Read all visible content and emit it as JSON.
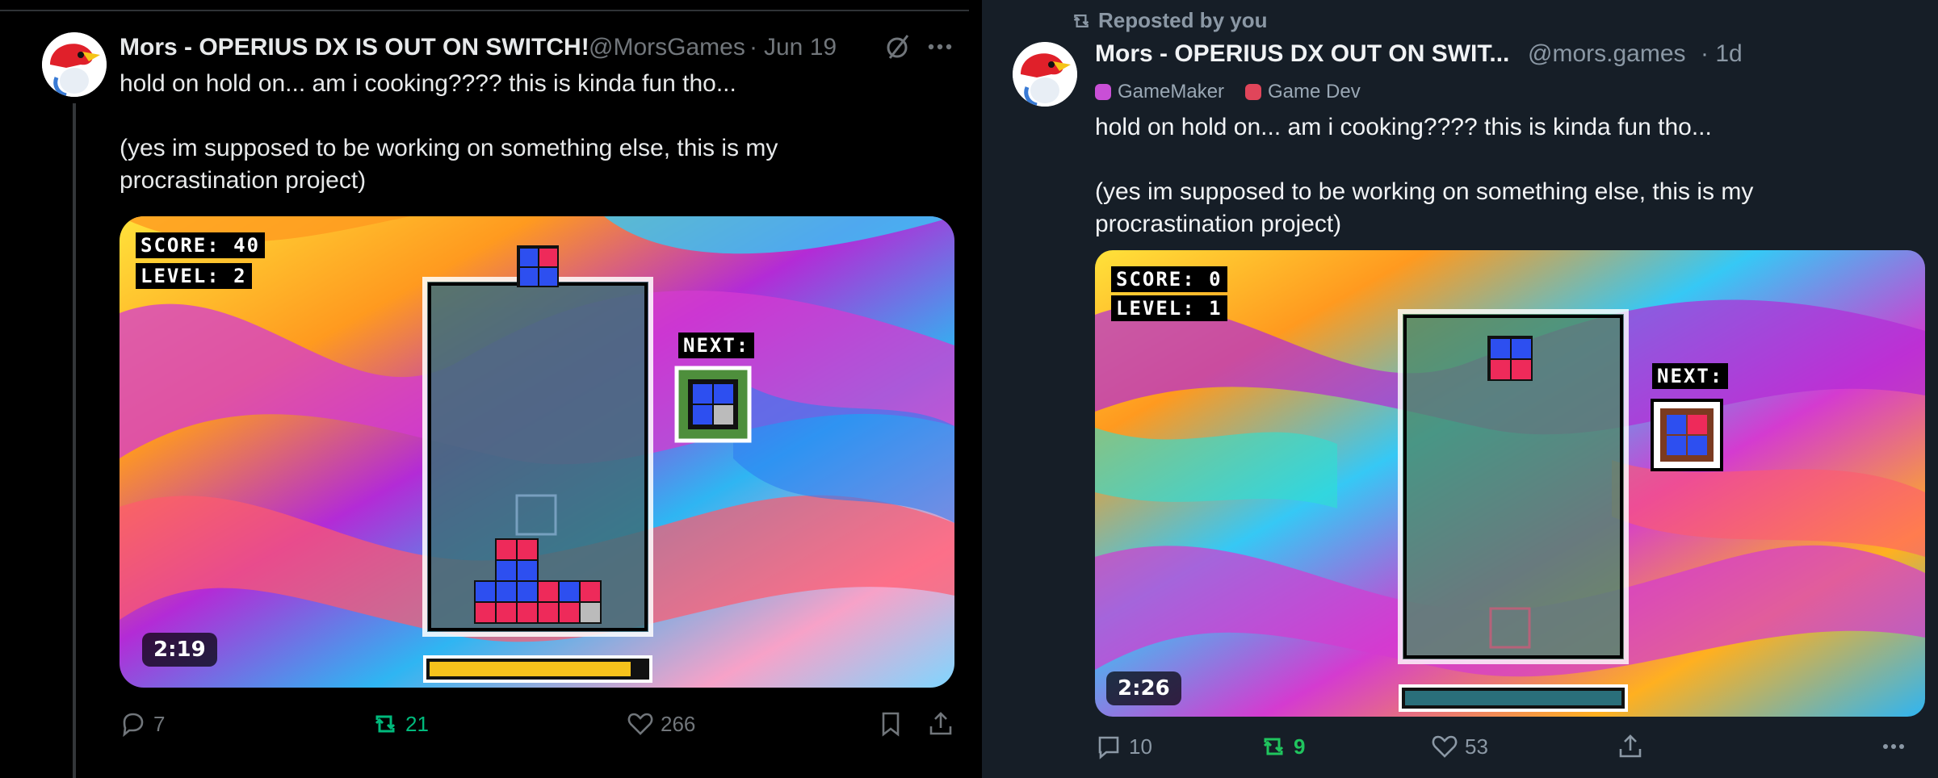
{
  "left_post": {
    "author_name": "Mors - OPERIUS DX IS OUT ON SWITCH!",
    "handle": "@MorsGames",
    "separator": "·",
    "date": "Jun 19",
    "text": "hold on hold on... am i cooking???? this is kinda fun tho...\n\n(yes im supposed to be working on something else, this is my procrastination project)",
    "video": {
      "duration": "2:19",
      "score_label": "SCORE: 40",
      "level_label": "LEVEL: 2",
      "next_label": "NEXT:",
      "progress": 0.93
    },
    "actions": {
      "replies": "7",
      "reposts": "21",
      "likes": "266"
    },
    "colors": {
      "repost_active": "#00ba7c",
      "icon": "#71767b"
    }
  },
  "right_post": {
    "reposted_by": "Reposted by you",
    "author_name": "Mors - OPERIUS DX OUT ON SWIT...",
    "handle": "@mors.games",
    "time": "· 1d",
    "tags": [
      {
        "label": "GameMaker",
        "color": "#c94fd6"
      },
      {
        "label": "Game Dev",
        "color": "#e0455a"
      }
    ],
    "text": "hold on hold on... am i cooking???? this is kinda fun tho...\n\n(yes im supposed to be working on something else, this is my procrastination project)",
    "video": {
      "duration": "2:26",
      "score_label": "SCORE: 0",
      "level_label": "LEVEL: 1",
      "next_label": "NEXT:",
      "progress": 0.0
    },
    "actions": {
      "replies": "10",
      "reposts": "9",
      "likes": "53"
    },
    "colors": {
      "repost_active": "#20c55e",
      "icon": "#8b98a5"
    }
  }
}
